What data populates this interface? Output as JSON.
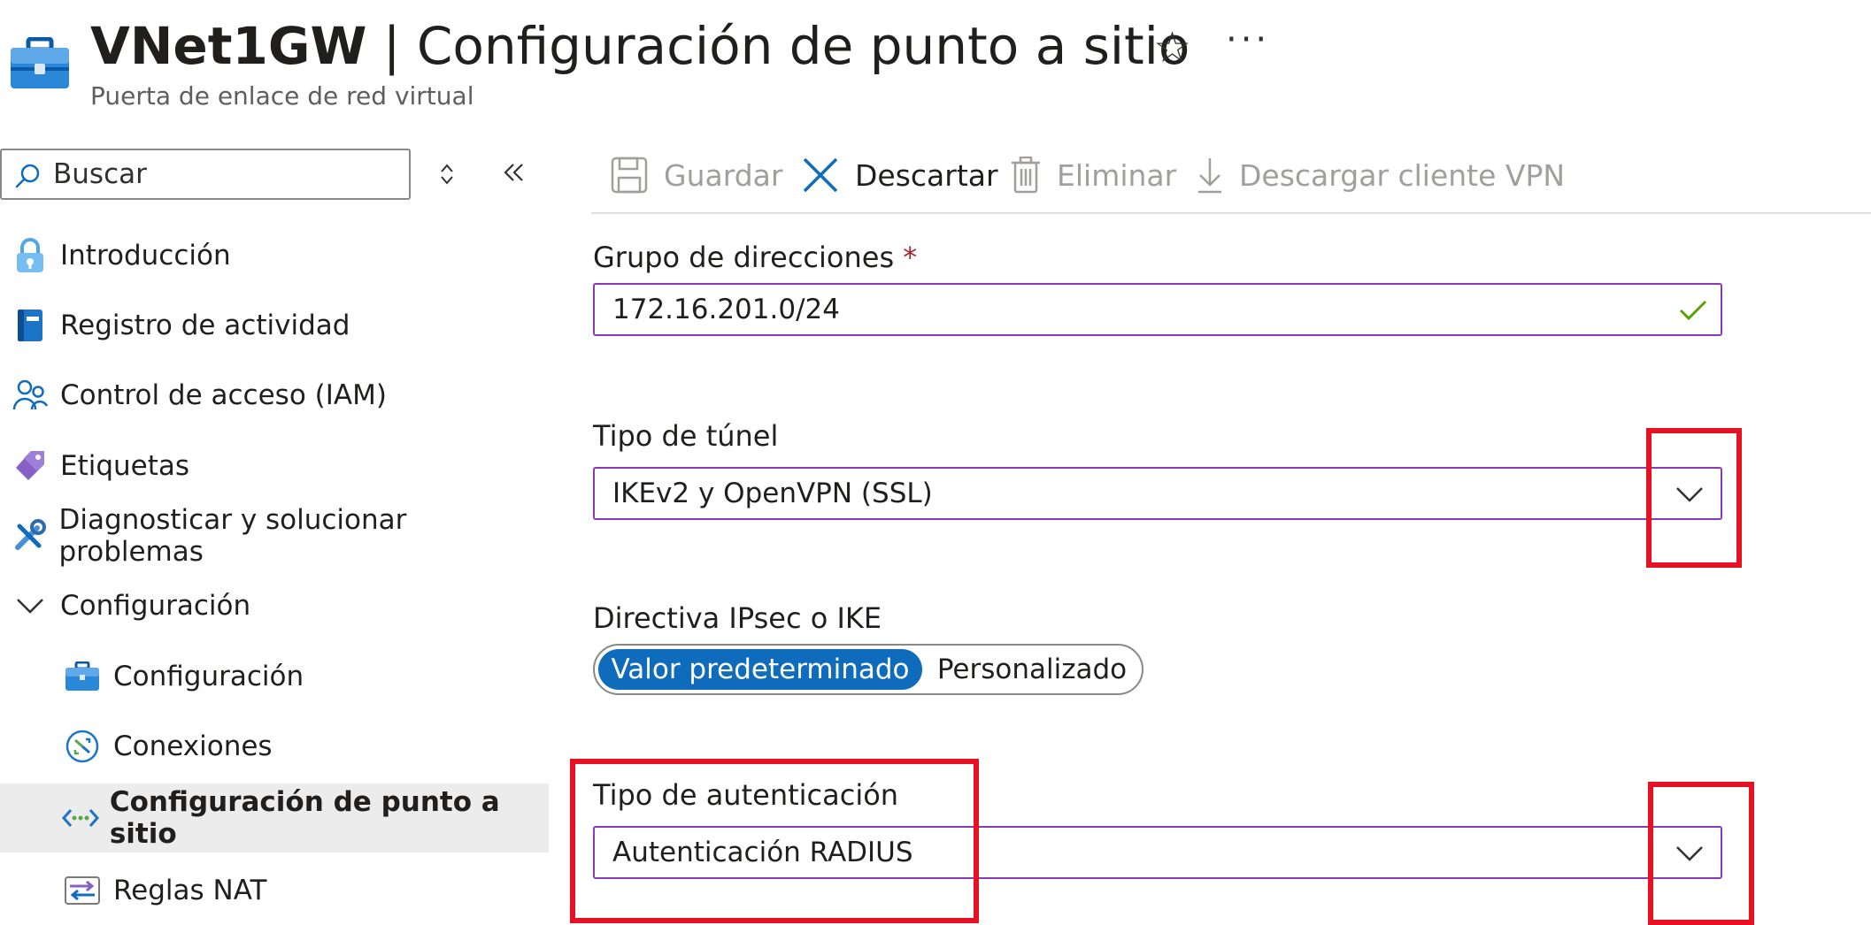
{
  "header": {
    "resource_name": "VNet1GW",
    "separator": " | ",
    "page_name": "Configuración de punto a sitio",
    "subtitle": "Puerta de enlace de red virtual",
    "favorite_glyph": "☆",
    "more_glyph": "···"
  },
  "sidebar": {
    "search": {
      "placeholder": "Buscar"
    },
    "items": [
      {
        "label": "Introducción",
        "icon": "lock-icon"
      },
      {
        "label": "Registro de actividad",
        "icon": "book-icon"
      },
      {
        "label": "Control de acceso (IAM)",
        "icon": "people-icon"
      },
      {
        "label": "Etiquetas",
        "icon": "tag-icon"
      },
      {
        "label": "Diagnosticar y solucionar problemas",
        "icon": "wrench-icon"
      },
      {
        "label": "Configuración",
        "icon": "chevron-down-icon"
      },
      {
        "label": "Configuración",
        "icon": "toolbox-icon"
      },
      {
        "label": "Conexiones",
        "icon": "connections-icon"
      },
      {
        "label": "Configuración de punto a sitio",
        "icon": "point-to-site-icon",
        "selected": true
      },
      {
        "label": "Reglas NAT",
        "icon": "nat-rules-icon"
      }
    ]
  },
  "toolbar": {
    "save_label": "Guardar",
    "discard_label": "Descartar",
    "delete_label": "Eliminar",
    "download_label": "Descargar cliente VPN"
  },
  "form": {
    "address_pool": {
      "label": "Grupo de direcciones",
      "required_mark": "*",
      "value": "172.16.201.0/24"
    },
    "tunnel_type": {
      "label": "Tipo de túnel",
      "value": "IKEv2 y OpenVPN (SSL)"
    },
    "ipsec_policy": {
      "label": "Directiva IPsec o IKE",
      "options": [
        "Valor predeterminado",
        "Personalizado"
      ],
      "selected": "Valor predeterminado"
    },
    "auth_type": {
      "label": "Tipo de autenticación",
      "value": "Autenticación RADIUS"
    }
  },
  "colors": {
    "accent": "#0f6cbd",
    "field_border": "#8a3ab9",
    "highlight": "#e81123",
    "selected_nav_bg": "#ececec"
  }
}
